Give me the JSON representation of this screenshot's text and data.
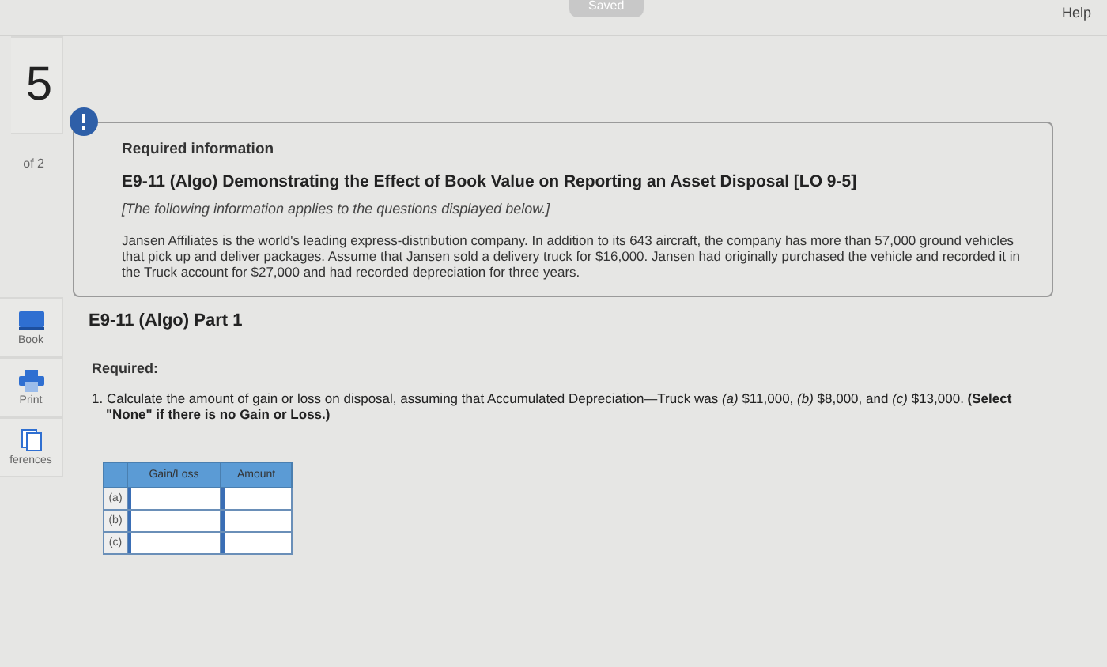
{
  "top_bar": {
    "saved_label": "Saved",
    "help_label": "Help"
  },
  "sidebar": {
    "question_number": "5",
    "question_count": "of 2",
    "tools": [
      {
        "kind": "book",
        "label": "Book"
      },
      {
        "kind": "print",
        "label": "Print"
      },
      {
        "kind": "references",
        "label": "ferences"
      }
    ]
  },
  "info_box": {
    "heading": "Required information",
    "title": "E9-11 (Algo) Demonstrating the Effect of Book Value on Reporting an Asset Disposal [LO 9-5]",
    "note": "[The following information applies to the questions displayed below.]",
    "body": "Jansen Affiliates is the world's leading express-distribution company. In addition to its 643 aircraft, the company has more than 57,000 ground vehicles that pick up and deliver packages. Assume that Jansen sold a delivery truck for $16,000. Jansen had originally purchased the vehicle and recorded it in the Truck account for $27,000 and had recorded depreciation for three years."
  },
  "part_title": "E9-11 (Algo) Part 1",
  "required_label": "Required:",
  "question": "1. Calculate the amount of gain or loss on disposal, assuming that Accumulated Depreciation—Truck was *(a)* $11,000, *(b)* $8,000, and *(c)* $13,000. **(Select \"None\" if there is no Gain or Loss.)**",
  "answer_table": {
    "columns": [
      "Gain/Loss",
      "Amount"
    ],
    "rows": [
      {
        "label": "(a)"
      },
      {
        "label": "(b)"
      },
      {
        "label": "(c)"
      }
    ]
  }
}
